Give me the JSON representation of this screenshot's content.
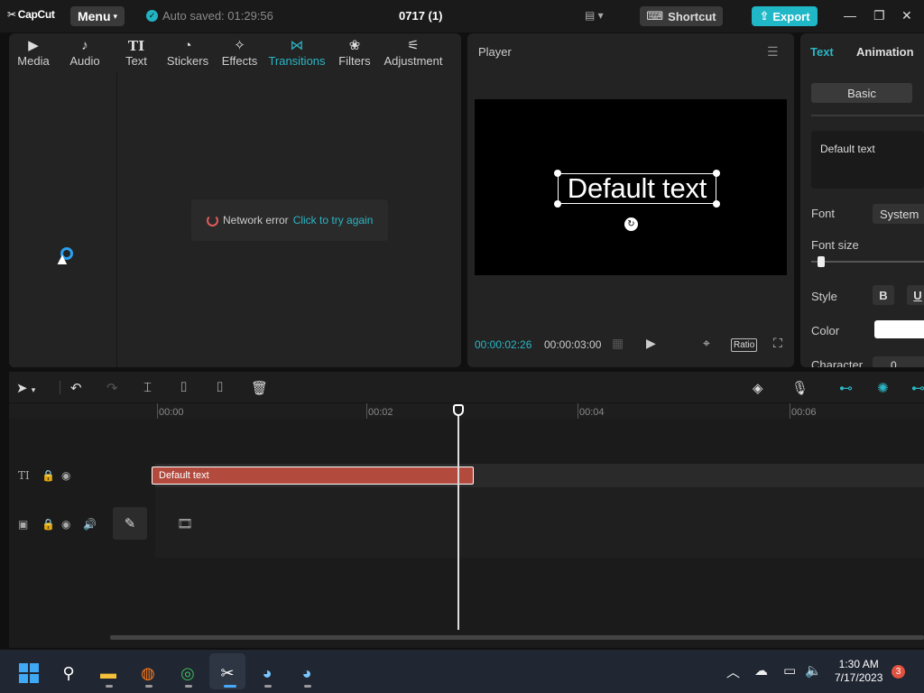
{
  "app": {
    "logo_text": "CapCut",
    "menu_label": "Menu",
    "autosave_text": "Auto saved: 01:29:56",
    "project_title": "0717 (1)",
    "shortcut_label": "Shortcut",
    "export_label": "Export",
    "accent_color": "#20b7c7"
  },
  "tools": [
    {
      "label": "Media",
      "icon": "media-icon",
      "glyph": "▶"
    },
    {
      "label": "Audio",
      "icon": "audio-icon",
      "glyph": "♪"
    },
    {
      "label": "Text",
      "icon": "text-icon",
      "glyph": "TI"
    },
    {
      "label": "Stickers",
      "icon": "stickers-icon",
      "glyph": "◔"
    },
    {
      "label": "Effects",
      "icon": "effects-icon",
      "glyph": "✧"
    },
    {
      "label": "Transitions",
      "icon": "transitions-icon",
      "glyph": "⋈"
    },
    {
      "label": "Filters",
      "icon": "filters-icon",
      "glyph": "❀"
    },
    {
      "label": "Adjustment",
      "icon": "adjustment-icon",
      "glyph": "⚟"
    }
  ],
  "active_tool": "Transitions",
  "network_error": {
    "text": "Network error",
    "link": "Click to try again"
  },
  "player": {
    "title": "Player",
    "overlay_text": "Default text",
    "current_time": "00:00:02:26",
    "total_time": "00:00:03:00",
    "ratio_label": "Ratio"
  },
  "inspector": {
    "tab_text": "Text",
    "tab_animation": "Animation",
    "subtab_basic": "Basic",
    "text_value": "Default text",
    "font_label": "Font",
    "font_value": "System",
    "font_size_label": "Font size",
    "style_label": "Style",
    "bold_label": "B",
    "underline_label": "U",
    "color_label": "Color",
    "color_value": "#ffffff",
    "character_label": "Character",
    "character_value": "0"
  },
  "timeline": {
    "ruler": [
      "00:00",
      "00:02",
      "00:04",
      "00:06"
    ],
    "text_clip_label": "Default text",
    "text_clip_color": "#b34a3e"
  },
  "taskbar": {
    "time": "1:30 AM",
    "date": "7/17/2023",
    "notification_count": "3"
  }
}
